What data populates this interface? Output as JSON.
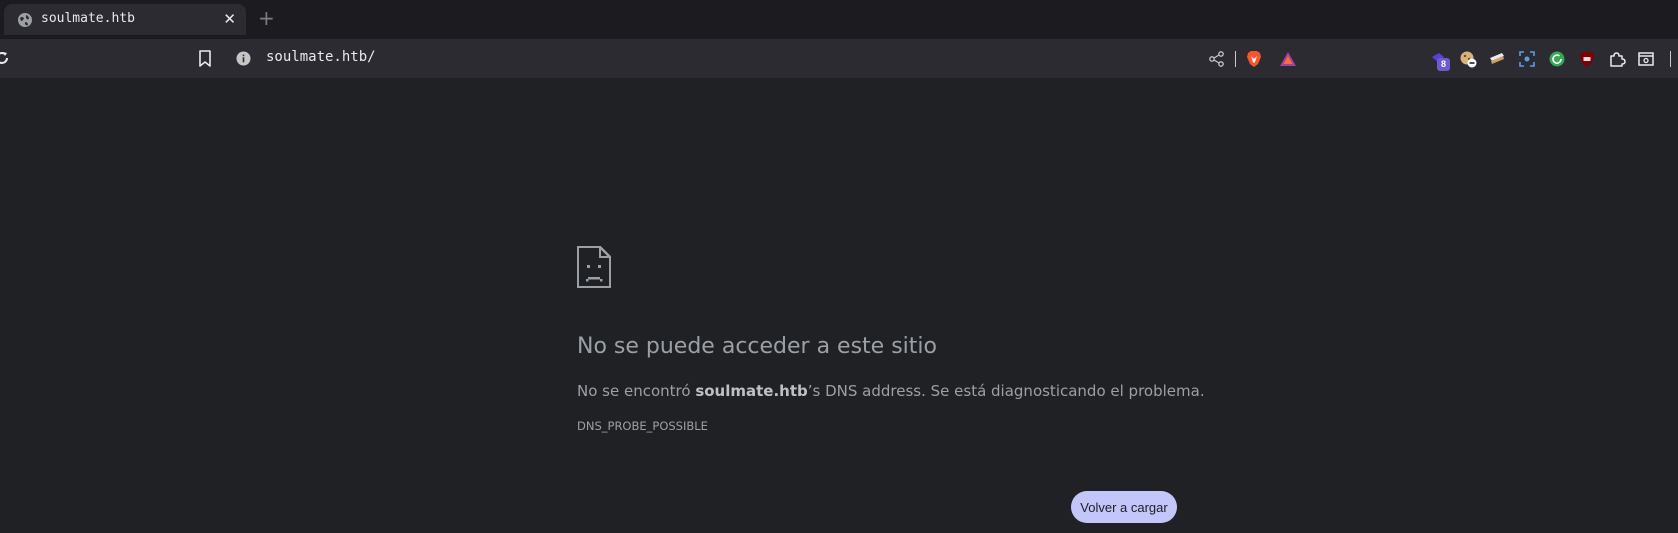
{
  "tab": {
    "title": "soulmate.htb",
    "close_glyph": "✕",
    "new_tab_glyph": "+"
  },
  "toolbar": {
    "url": "soulmate.htb/",
    "extension_badge": "8"
  },
  "icons": {
    "tab_favicon": "globe-icon",
    "reload": "reload-icon",
    "bookmark": "bookmark-icon",
    "site_info": "info-icon",
    "share": "share-icon",
    "brave_shields": "brave-shields-icon",
    "brave_rewards": "brave-rewards-icon",
    "extensions": "puzzle-icon",
    "error": "sad-page-icon"
  },
  "error": {
    "title": "No se puede acceder a este sitio",
    "desc_prefix": "No se encontró ",
    "desc_host": "soulmate.htb",
    "desc_suffix": "’s DNS address. Se está diagnosticando el problema.",
    "code": "DNS_PROBE_POSSIBLE",
    "reload_button": "Volver a cargar"
  },
  "colors": {
    "page_background": "#202124",
    "toolbar_background": "#2b2b31",
    "button_background": "#c2c6f9",
    "text_secondary": "#9aa0a6"
  }
}
